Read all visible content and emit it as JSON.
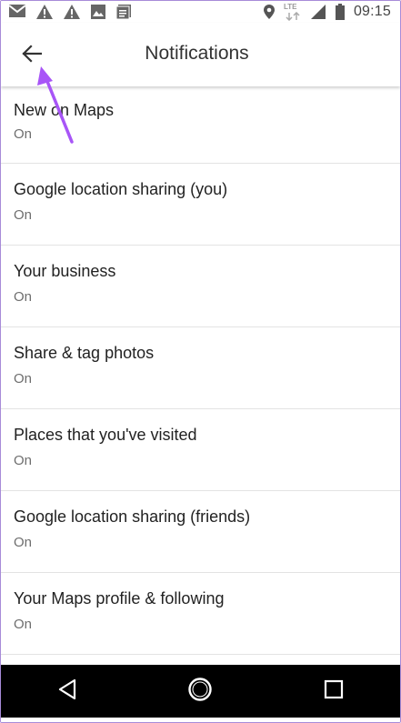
{
  "status_bar": {
    "time": "09:15",
    "network_label": "LTE",
    "icons_left": [
      "gmail-icon",
      "warning-icon",
      "warning-icon",
      "image-icon",
      "document-icon"
    ],
    "icons_right": [
      "location-icon",
      "lte-icon",
      "signal-icon",
      "battery-icon"
    ]
  },
  "app_bar": {
    "title": "Notifications",
    "back_icon": "back-arrow-icon"
  },
  "settings": [
    {
      "title": "New on Maps",
      "status": "On"
    },
    {
      "title": "Google location sharing (you)",
      "status": "On"
    },
    {
      "title": "Your business",
      "status": "On"
    },
    {
      "title": "Share & tag photos",
      "status": "On"
    },
    {
      "title": "Places that you've visited",
      "status": "On"
    },
    {
      "title": "Google location sharing (friends)",
      "status": "On"
    },
    {
      "title": "Your Maps profile & following",
      "status": "On"
    }
  ],
  "nav_bar": {
    "icons": [
      "back-triangle-icon",
      "home-circle-icon",
      "recents-square-icon"
    ]
  },
  "colors": {
    "annotation_arrow": "#a855f7",
    "frame_border": "#a78bd8"
  }
}
